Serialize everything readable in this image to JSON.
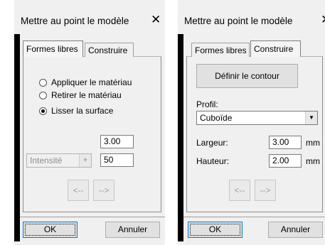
{
  "dialog_left": {
    "title": "Mettre au point le modèle",
    "close_glyph": "✕",
    "tabs": [
      {
        "label": "Formes libres",
        "active": true
      },
      {
        "label": "Construire",
        "active": false
      }
    ],
    "radios": [
      {
        "label": "Appliquer le matériau",
        "selected": false
      },
      {
        "label": "Retirer le matériau",
        "selected": false
      },
      {
        "label": "Lisser la surface",
        "selected": true
      }
    ],
    "value_top": "3.00",
    "intensity_select": "Intensité",
    "intensity_value": "50",
    "prev_button": "<--",
    "next_button": "-->",
    "ok_button": "OK",
    "cancel_button": "Annuler"
  },
  "dialog_right": {
    "title": "Mettre au point le modèle",
    "close_glyph": "✕",
    "tabs": [
      {
        "label": "Formes libres",
        "active": false
      },
      {
        "label": "Construire",
        "active": true
      }
    ],
    "define_contour_button": "Définir le contour",
    "profile_label": "Profil:",
    "profile_value": "Cuboïde",
    "width_label": "Largeur:",
    "width_value": "3.00",
    "width_unit": "mm",
    "height_label": "Hauteur:",
    "height_value": "2.00",
    "height_unit": "mm",
    "prev_button": "<--",
    "next_button": "-->",
    "ok_button": "OK",
    "cancel_button": "Annuler"
  },
  "colors": {
    "dialog_bg": "#f0f0f0",
    "default_button_border": "#0078d7"
  }
}
